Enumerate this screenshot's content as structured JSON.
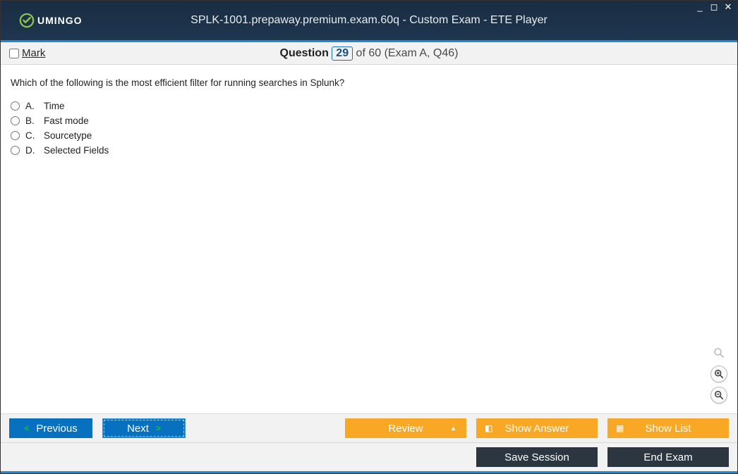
{
  "window": {
    "title": "SPLK-1001.prepaway.premium.exam.60q - Custom Exam - ETE Player",
    "logo_text": "UMINGO"
  },
  "header": {
    "mark_label": "Mark",
    "question_word": "Question",
    "question_number": "29",
    "of_text": "of 60 (Exam A, Q46)"
  },
  "question": {
    "text": "Which of the following is the most efficient filter for running searches in Splunk?",
    "options": [
      {
        "letter": "A.",
        "text": "Time"
      },
      {
        "letter": "B.",
        "text": "Fast mode"
      },
      {
        "letter": "C.",
        "text": "Sourcetype"
      },
      {
        "letter": "D.",
        "text": "Selected Fields"
      }
    ]
  },
  "toolbar": {
    "previous": "Previous",
    "next": "Next",
    "review": "Review",
    "show_answer": "Show Answer",
    "show_list": "Show List",
    "save_session": "Save Session",
    "end_exam": "End Exam"
  }
}
